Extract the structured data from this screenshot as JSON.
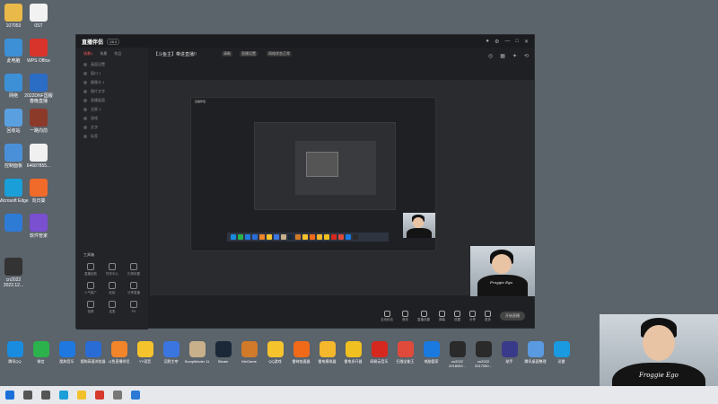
{
  "desktop": {
    "icons": [
      {
        "label": "107053",
        "color": "#e9b949"
      },
      {
        "label": "0ST",
        "color": "#f2f2f2"
      },
      {
        "label": "此电脑",
        "color": "#3d8fd6"
      },
      {
        "label": "WPS Office",
        "color": "#d9342b"
      },
      {
        "label": "网络",
        "color": "#3d8fd6"
      },
      {
        "label": "2022DNF国服春晚直播",
        "color": "#2b6cc4"
      },
      {
        "label": "回收站",
        "color": "#5aa0e0"
      },
      {
        "label": "一路向前",
        "color": "#8b3a2a"
      },
      {
        "label": "控制面板",
        "color": "#4a90d9"
      },
      {
        "label": "64687855...",
        "color": "#f0f0f0"
      },
      {
        "label": "Microsoft Edge",
        "color": "#1a9fd8"
      },
      {
        "label": "向日葵",
        "color": "#f06a2a"
      },
      {
        "label": "",
        "color": "#2e7bd6"
      },
      {
        "label": "软件管家",
        "color": "#7a4fd0"
      },
      {
        "label": "cn2022 2022.12...",
        "color": "#333"
      }
    ]
  },
  "app": {
    "logo": "直播伴侣",
    "badge": "V8.0",
    "sidebar_tabs": [
      "场景1",
      "场景",
      "作品"
    ],
    "sources": [
      "画面设置",
      "窗口 1",
      "摄像头 1",
      "图片文字",
      "直播画面",
      "全屏 1",
      "游戏",
      "文字",
      "标签"
    ],
    "tools_title": "工具箱",
    "tools": [
      "直播回放",
      "任务中心",
      "礼物设置",
      "人气推广",
      "贴纸",
      "分享直播",
      "投屏",
      "连麦",
      "PK"
    ],
    "stage_title": "【斗鱼主】带进直播!!",
    "stage_chips": [
      "清晰",
      "直播设置",
      "网络状态正常"
    ],
    "bottom_bar": [
      "互动玩法",
      "音效",
      "直播设置",
      "弹幕",
      "设置",
      "分享",
      "更多"
    ],
    "live_button": "开始直播",
    "nested_tab": "直播伴侣"
  },
  "dock": [
    {
      "label": "腾讯QQ",
      "color": "#1a8ce0"
    },
    {
      "label": "微信",
      "color": "#2bb24c"
    },
    {
      "label": "酷狗音乐",
      "color": "#1e78e0"
    },
    {
      "label": "搜狗高速浏览器",
      "color": "#2a6cd6"
    },
    {
      "label": "斗鱼直播伴侣",
      "color": "#f2842a"
    },
    {
      "label": "YY语音",
      "color": "#f5c32c"
    },
    {
      "label": "沉默主宰",
      "color": "#3a75e0"
    },
    {
      "label": "Sumpfkinder 11",
      "color": "#c8b08a"
    },
    {
      "label": "Steam",
      "color": "#1b2838"
    },
    {
      "label": "WeGame",
      "color": "#d07a2a"
    },
    {
      "label": "QQ游戏",
      "color": "#f5c32c"
    },
    {
      "label": "雷神加速器",
      "color": "#f06a1a"
    },
    {
      "label": "雷电模拟器",
      "color": "#f5b82c"
    },
    {
      "label": "雷电多开器",
      "color": "#f0c020"
    },
    {
      "label": "网易云音乐",
      "color": "#d6281e"
    },
    {
      "label": "扫描全能王",
      "color": "#e04a3a"
    },
    {
      "label": "电脑管家",
      "color": "#1a7ae0"
    },
    {
      "label": "cn2022 2018053...",
      "color": "#2a2a2a"
    },
    {
      "label": "cn2022 2017050...",
      "color": "#2a2a2a"
    },
    {
      "label": "助手",
      "color": "#3a3a8a"
    },
    {
      "label": "腾讯桌面整理",
      "color": "#5a9ae0"
    },
    {
      "label": "迅雷",
      "color": "#1a9ae0"
    }
  ],
  "taskbar": {
    "icons": [
      "windows-icon",
      "search-icon",
      "task-view-icon",
      "edge-icon",
      "explorer-icon",
      "chrome-icon",
      "settings-icon",
      "media-icon"
    ]
  },
  "streamer": {
    "shirt_text": "Froggie Ego"
  }
}
